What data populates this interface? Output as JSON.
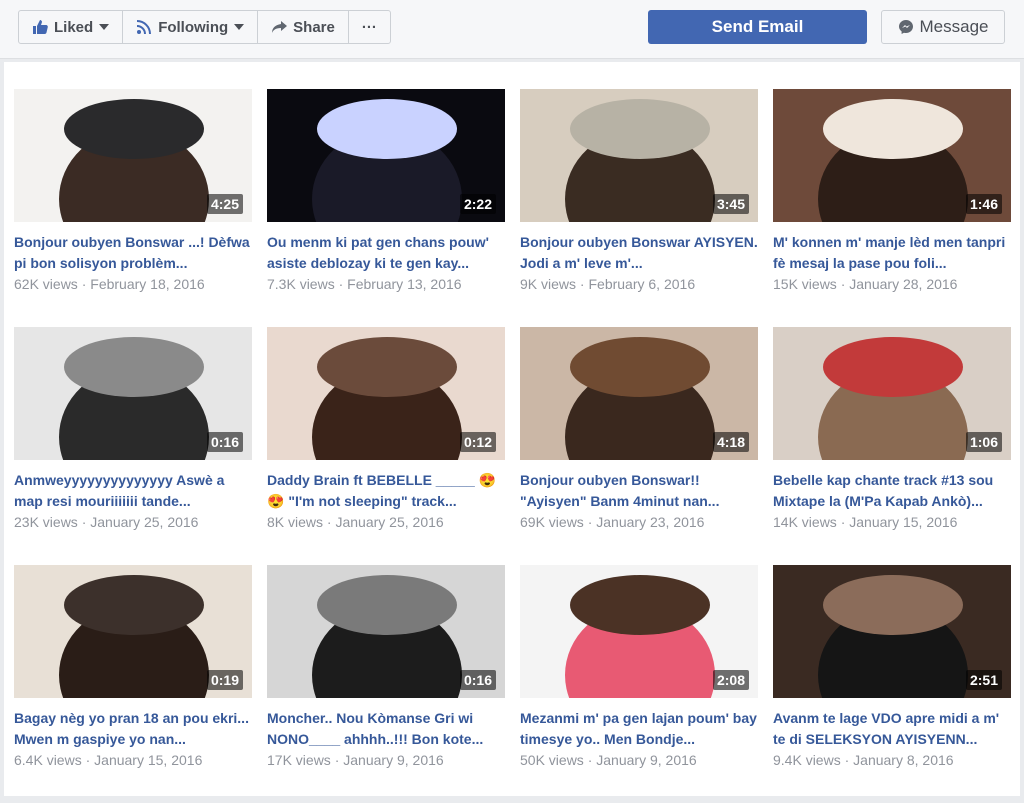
{
  "header": {
    "liked_label": "Liked",
    "following_label": "Following",
    "share_label": "Share",
    "more_label": "···",
    "send_email_label": "Send Email",
    "message_label": "Message"
  },
  "videos": [
    {
      "title": "Bonjour oubyen Bonswar ...! Dèfwa pi bon solisyon problèm...",
      "duration": "4:25",
      "views": "62K views",
      "date": "February 18, 2016"
    },
    {
      "title": "Ou menm ki pat gen chans pouw' asiste deblozay ki te gen kay...",
      "duration": "2:22",
      "views": "7.3K views",
      "date": "February 13, 2016"
    },
    {
      "title": "Bonjour oubyen Bonswar AYISYEN. Jodi a m' leve m'...",
      "duration": "3:45",
      "views": "9K views",
      "date": "February 6, 2016"
    },
    {
      "title": "M' konnen m' manje lèd men tanpri fè mesaj la pase pou foli...",
      "duration": "1:46",
      "views": "15K views",
      "date": "January 28, 2016"
    },
    {
      "title": "Anmweyyyyyyyyyyyyyy Aswè a map resi mouriiiiiii tande...",
      "duration": "0:16",
      "views": "23K views",
      "date": "January 25, 2016"
    },
    {
      "title": "Daddy Brain ft BEBELLE _____ 😍😍 \"I'm not sleeping\" track...",
      "duration": "0:12",
      "views": "8K views",
      "date": "January 25, 2016"
    },
    {
      "title": "Bonjour oubyen Bonswar!! \"Ayisyen\" Banm 4minut nan...",
      "duration": "4:18",
      "views": "69K views",
      "date": "January 23, 2016"
    },
    {
      "title": "Bebelle kap chante track #13 sou Mixtape la (M'Pa Kapab Ankò)...",
      "duration": "1:06",
      "views": "14K views",
      "date": "January 15, 2016"
    },
    {
      "title": "Bagay nèg yo pran 18 an pou ekri... Mwen m gaspiye yo nan...",
      "duration": "0:19",
      "views": "6.4K views",
      "date": "January 15, 2016"
    },
    {
      "title": "Moncher.. Nou Kòmanse Gri wi NONO____ ahhhh..!!! Bon kote...",
      "duration": "0:16",
      "views": "17K views",
      "date": "January 9, 2016"
    },
    {
      "title": "Mezanmi m' pa gen lajan poum' bay timesye yo.. Men Bondje...",
      "duration": "2:08",
      "views": "50K views",
      "date": "January 9, 2016"
    },
    {
      "title": "Avanm te lage VDO apre midi a m' te di SELEKSYON AYISYENN...",
      "duration": "2:51",
      "views": "9.4K views",
      "date": "January 8, 2016"
    }
  ],
  "colors": {
    "link": "#365899",
    "primary": "#4267b2",
    "meta": "#90949c"
  }
}
